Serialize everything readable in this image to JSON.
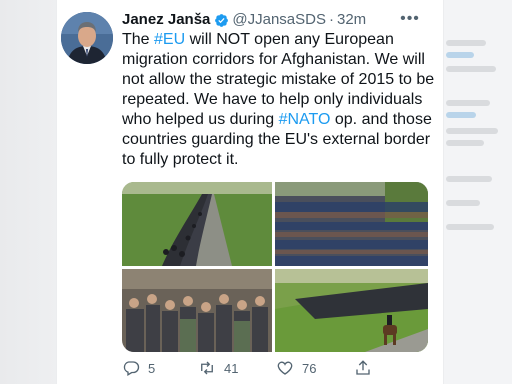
{
  "tweet": {
    "author_name": "Janez Janša",
    "handle": "@JJansaSDS",
    "separator": "·",
    "time": "32m",
    "text": {
      "part1": "The ",
      "hashtag1": "#EU",
      "part2": " will NOT open any European migration corridors for Afghanistan.  We will not allow the strategic mistake of 2015 to be repeated. We have to help only individuals who helped us during ",
      "hashtag2": "#NATO",
      "part3": " op.  and those countries guarding the EU's external border to fully protect it."
    }
  },
  "actions": {
    "reply_count": "5",
    "retweet_count": "41",
    "like_count": "76"
  },
  "colors": {
    "accent": "#1d9bf0",
    "text": "#0f1419",
    "muted": "#536471",
    "verified": "#1d9bf0"
  },
  "icons": {
    "verified": "verified-badge-icon",
    "more": "more-options-icon",
    "reply": "reply-icon",
    "retweet": "retweet-icon",
    "like": "heart-icon",
    "share": "share-icon"
  }
}
